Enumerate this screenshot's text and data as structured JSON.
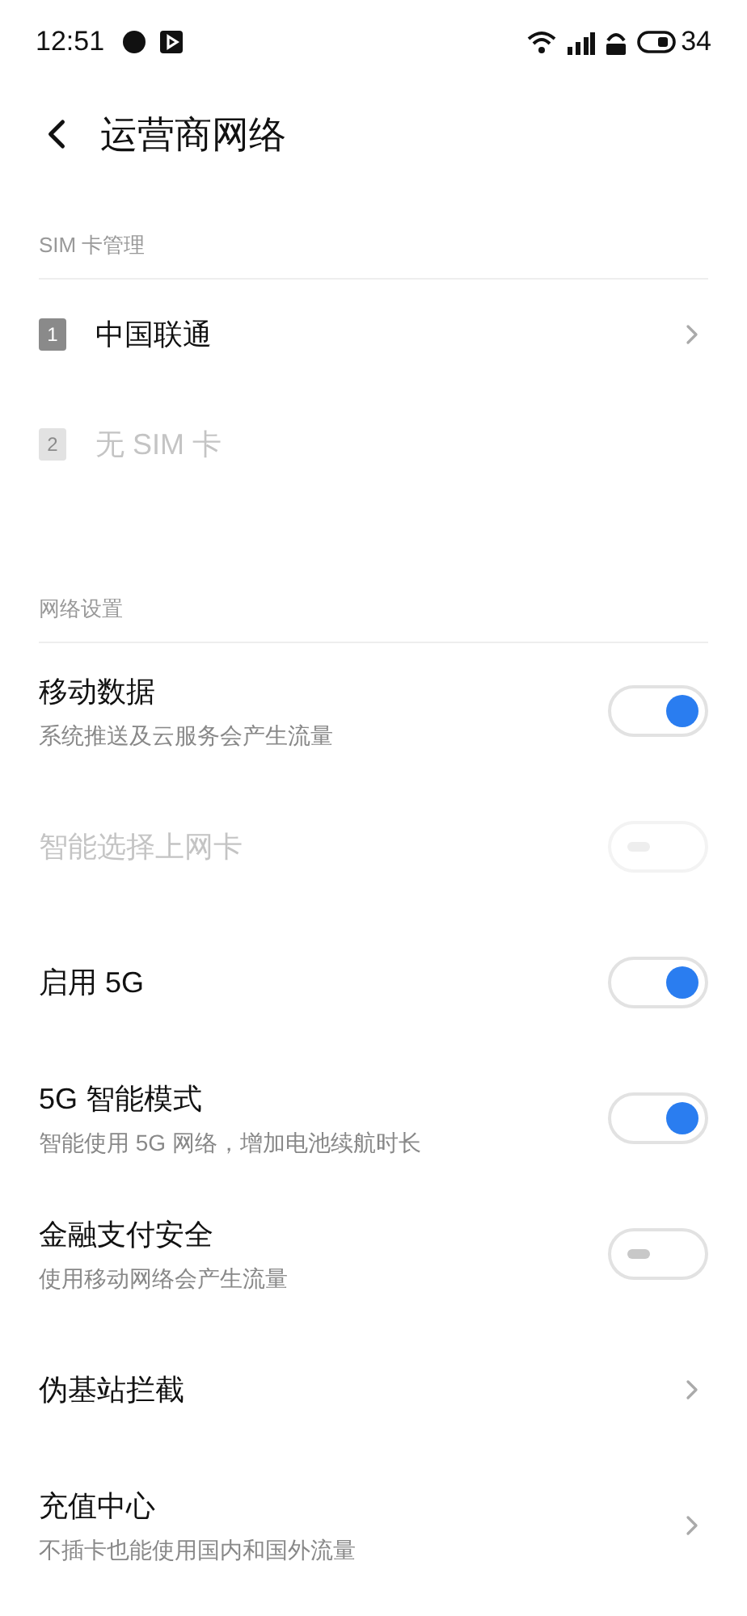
{
  "status_bar": {
    "time": "12:51",
    "battery": "34"
  },
  "header": {
    "title": "运营商网络"
  },
  "sim_section": {
    "label": "SIM 卡管理",
    "items": [
      {
        "slot": "1",
        "name": "中国联通",
        "disabled": false,
        "has_arrow": true
      },
      {
        "slot": "2",
        "name": "无 SIM 卡",
        "disabled": true,
        "has_arrow": false
      }
    ]
  },
  "network_section": {
    "label": "网络设置",
    "items": [
      {
        "kind": "toggle",
        "title": "移动数据",
        "subtitle": "系统推送及云服务会产生流量",
        "on": true,
        "disabled": false
      },
      {
        "kind": "toggle",
        "title": "智能选择上网卡",
        "on": false,
        "disabled": true
      },
      {
        "kind": "toggle",
        "title": "启用 5G",
        "on": true,
        "disabled": false
      },
      {
        "kind": "toggle",
        "title": "5G 智能模式",
        "subtitle": "智能使用 5G 网络，增加电池续航时长",
        "on": true,
        "disabled": false
      },
      {
        "kind": "toggle",
        "title": "金融支付安全",
        "subtitle": "使用移动网络会产生流量",
        "on": false,
        "disabled": false
      },
      {
        "kind": "link",
        "title": "伪基站拦截"
      },
      {
        "kind": "link",
        "title": "充值中心",
        "subtitle": "不插卡也能使用国内和国外流量"
      }
    ]
  }
}
